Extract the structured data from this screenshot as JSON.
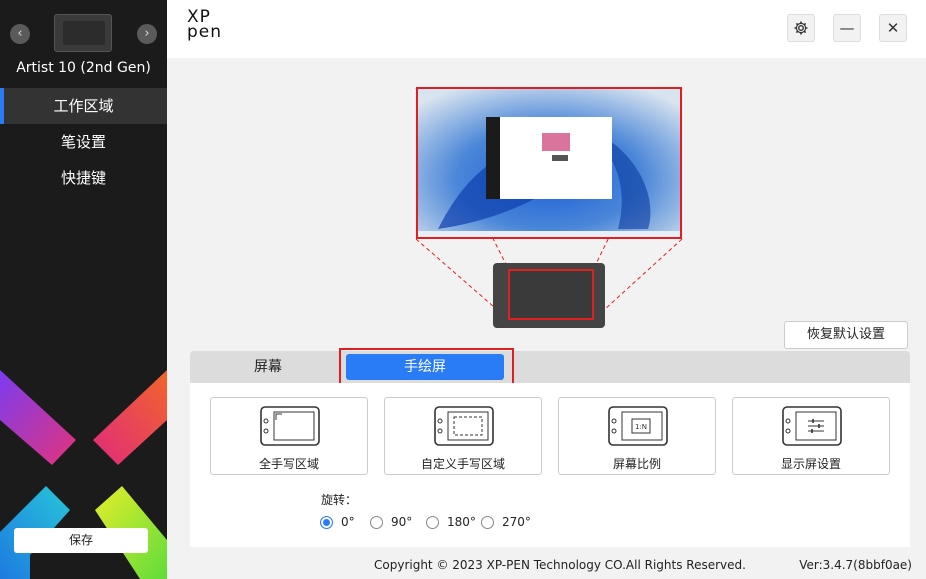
{
  "sidebar": {
    "device_name": "Artist 10 (2nd Gen)",
    "items": [
      {
        "label": "工作区域",
        "active": true
      },
      {
        "label": "笔设置",
        "active": false
      },
      {
        "label": "快捷键",
        "active": false
      }
    ],
    "save_label": "保存",
    "prev_icon": "chevron-left-icon",
    "next_icon": "chevron-right-icon"
  },
  "header": {
    "logo_top": "XP",
    "logo_bottom": "pen",
    "settings_icon": "gear-icon",
    "minimize_icon": "minimize-icon",
    "close_icon": "close-icon"
  },
  "main": {
    "reset_label": "恢复默认设置",
    "tabs": [
      {
        "label": "屏幕",
        "active": false
      },
      {
        "label": "手绘屏",
        "active": true
      }
    ],
    "cards": [
      {
        "label": "全手写区域",
        "icon": "full-area-icon"
      },
      {
        "label": "自定义手写区域",
        "icon": "custom-area-icon"
      },
      {
        "label": "屏幕比例",
        "icon": "screen-ratio-icon"
      },
      {
        "label": "显示屏设置",
        "icon": "display-settings-icon"
      }
    ],
    "rotation": {
      "title": "旋转：",
      "options": [
        "0°",
        "90°",
        "180°",
        "270°"
      ],
      "selected": "0°"
    }
  },
  "footer": {
    "copyright": "Copyright © 2023  XP-PEN Technology CO.All Rights Reserved.",
    "version": "Ver:3.4.7(8bbf0ae)"
  },
  "colors": {
    "accent": "#2a7cf6",
    "highlight": "#e02020",
    "sidebar_bg": "#1b1b1b"
  }
}
